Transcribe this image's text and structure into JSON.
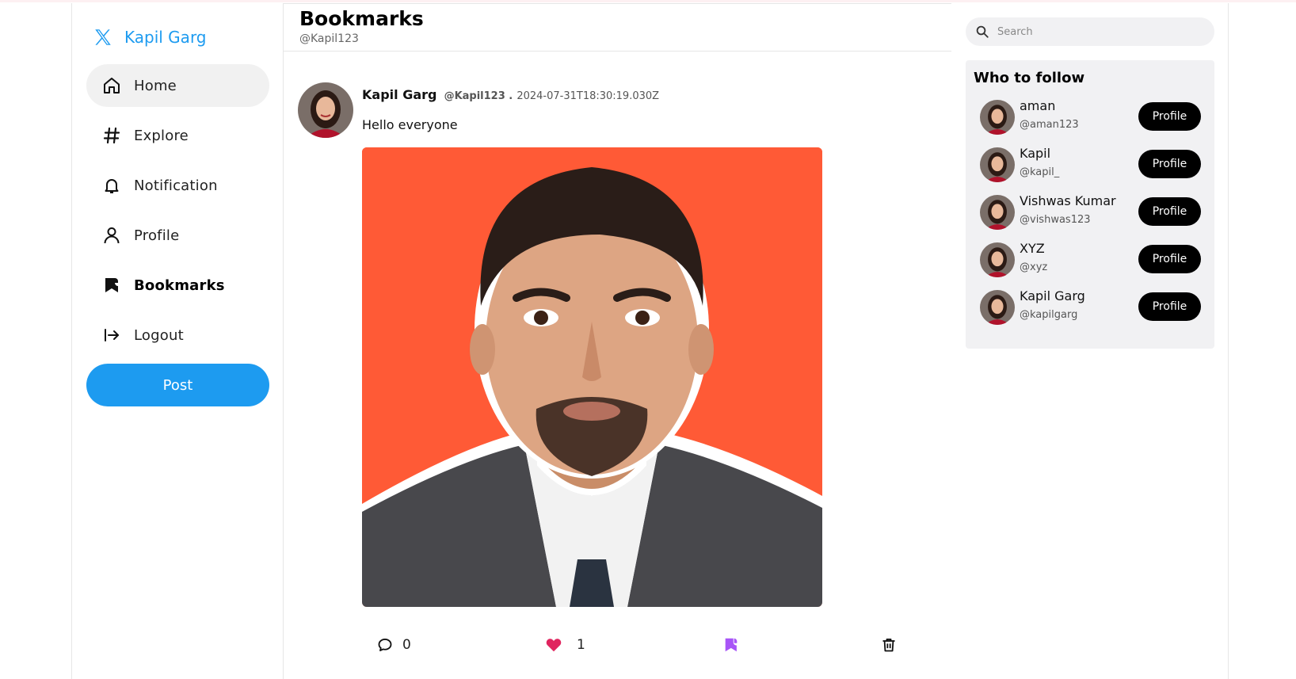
{
  "brand": {
    "name": "Kapil Garg",
    "icon": "x-logo-icon",
    "color": "#1d9bf0"
  },
  "nav": {
    "items": [
      {
        "label": "Home",
        "icon": "home-icon"
      },
      {
        "label": "Explore",
        "icon": "hashtag-icon"
      },
      {
        "label": "Notification",
        "icon": "bell-icon"
      },
      {
        "label": "Profile",
        "icon": "user-icon"
      },
      {
        "label": "Bookmarks",
        "icon": "bookmark-icon"
      },
      {
        "label": "Logout",
        "icon": "logout-icon"
      }
    ],
    "active": "Bookmarks",
    "hovered": "Home"
  },
  "post_button": {
    "label": "Post"
  },
  "header": {
    "title": "Bookmarks",
    "handle": "@Kapil123"
  },
  "post": {
    "author": "Kapil Garg",
    "handle": "@Kapil123 .",
    "timestamp": "2024-07-31T18:30:19.030Z",
    "text": "Hello everyone",
    "media_background": "#ff5a36",
    "comments": "0",
    "likes": "1",
    "like_color": "#e0245e",
    "bookmark_color": "#a855f7"
  },
  "search": {
    "placeholder": "Search"
  },
  "who_to_follow": {
    "title": "Who to follow",
    "button_label": "Profile",
    "users": [
      {
        "name": "aman",
        "handle": "@aman123"
      },
      {
        "name": "Kapil",
        "handle": "@kapil_"
      },
      {
        "name": "Vishwas Kumar",
        "handle": "@vishwas123"
      },
      {
        "name": "XYZ",
        "handle": "@xyz"
      },
      {
        "name": "Kapil Garg",
        "handle": "@kapilgarg"
      }
    ]
  }
}
